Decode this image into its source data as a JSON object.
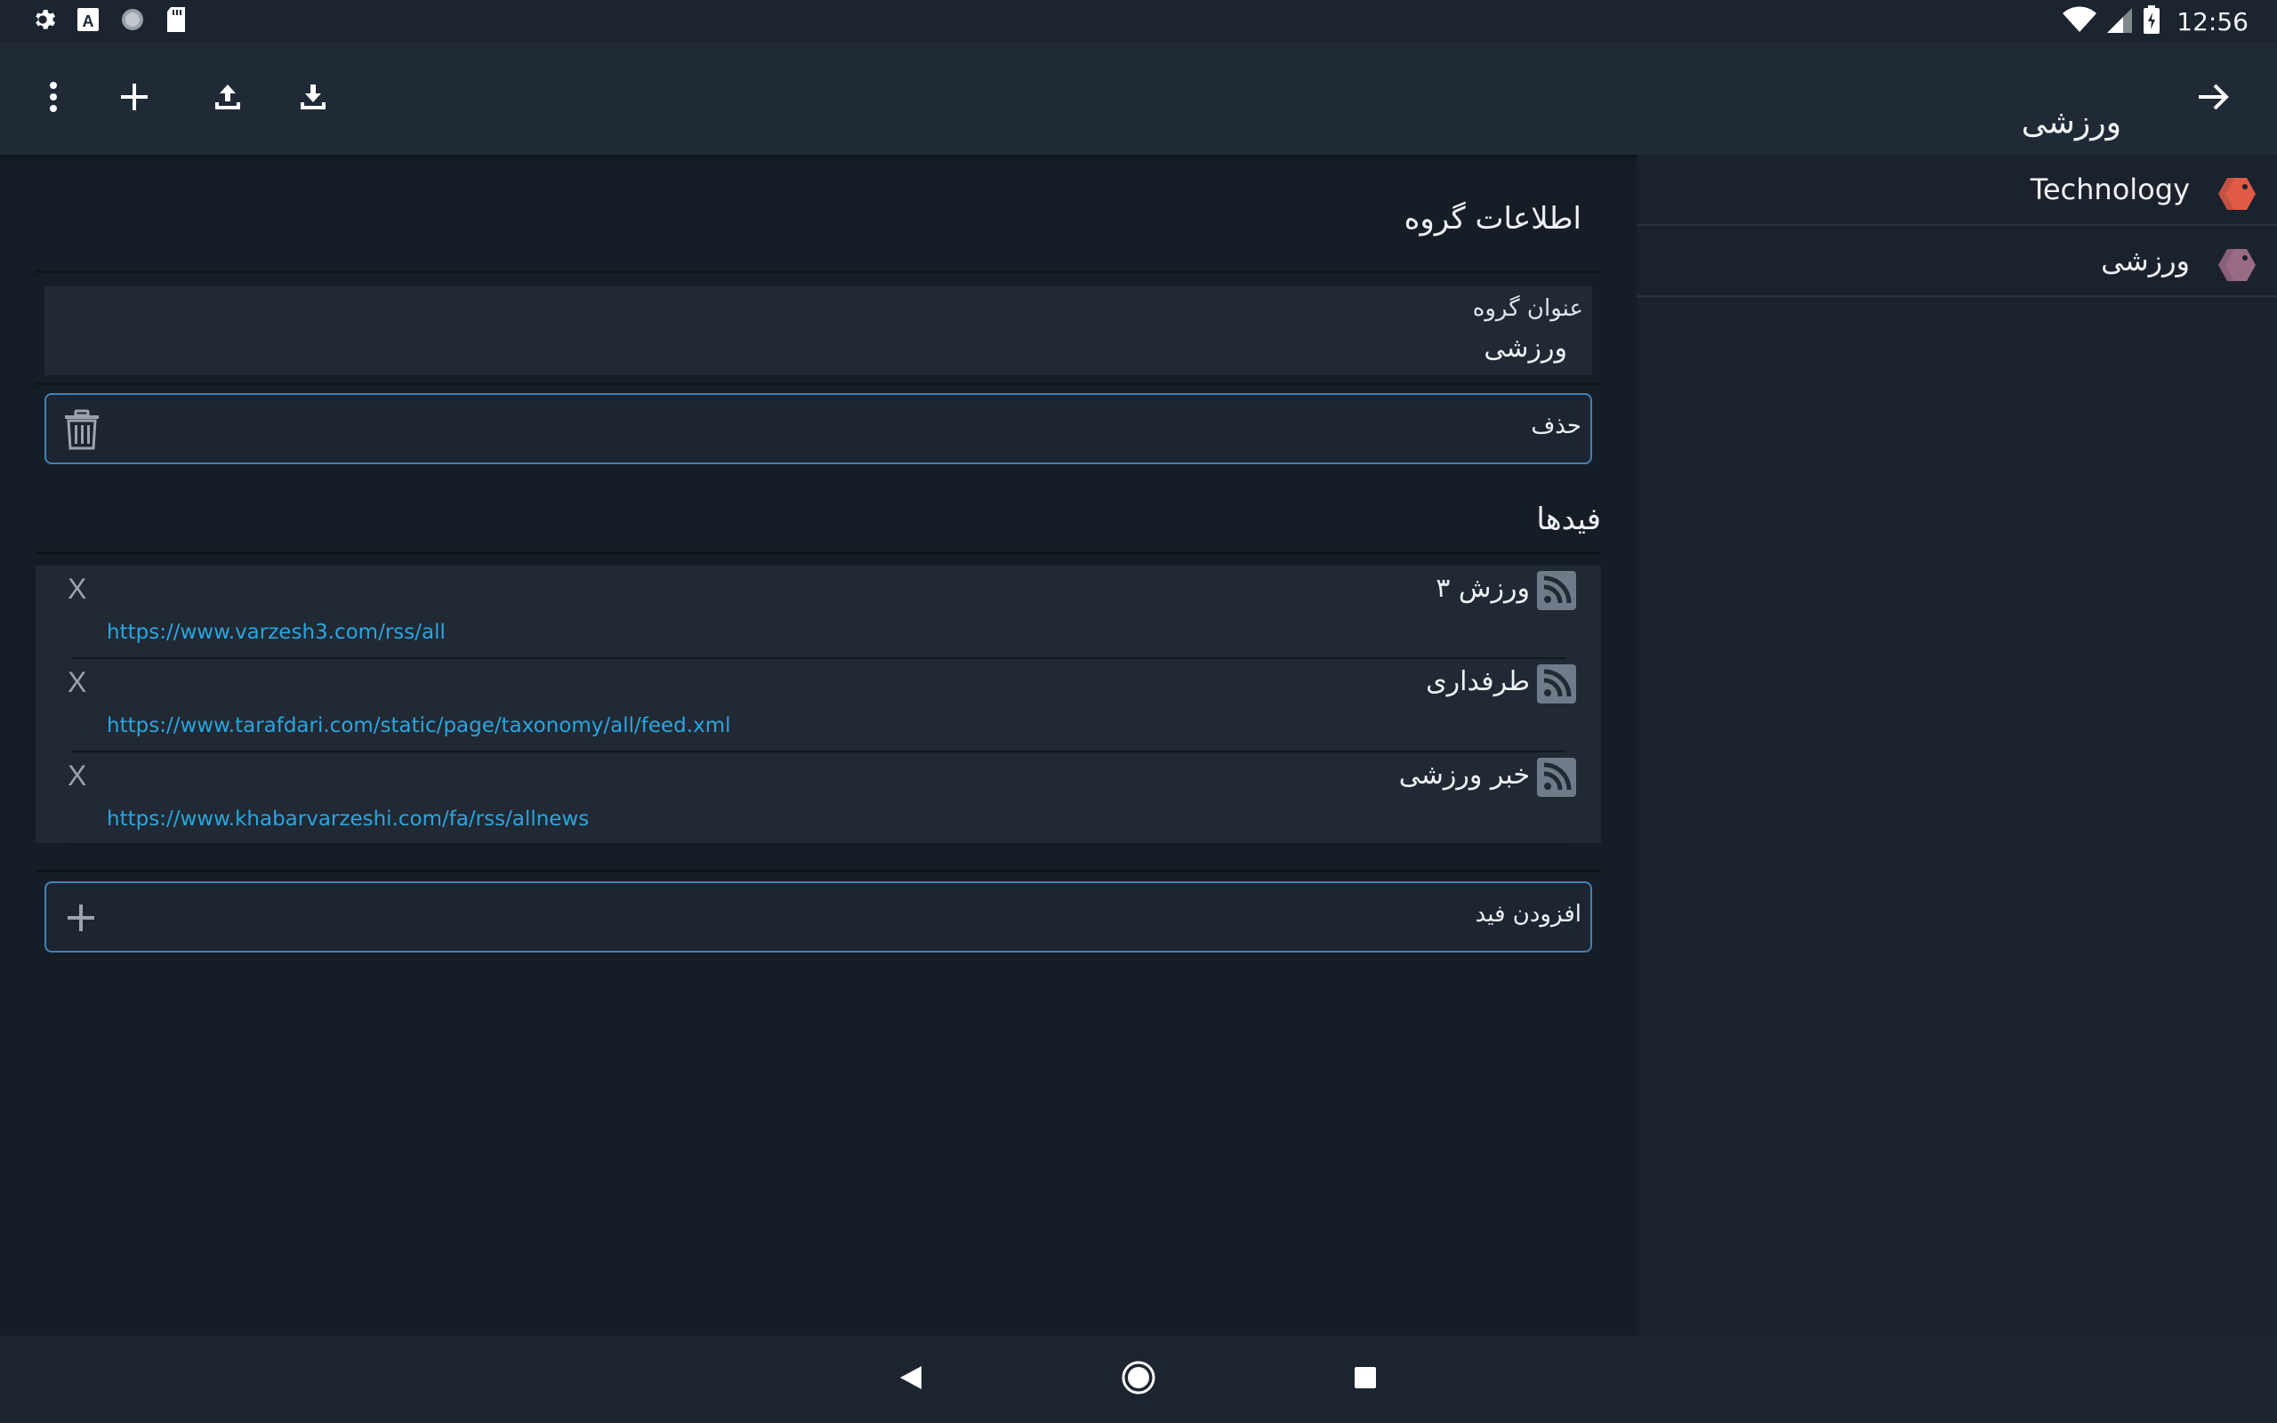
{
  "status_bar": {
    "time": "12:56",
    "icons": [
      "gear-icon",
      "text-a-icon",
      "circle-icon",
      "sd-card-icon",
      "wifi-icon",
      "signal-icon",
      "battery-icon"
    ]
  },
  "toolbar": {
    "title": "ورزشی",
    "actions": [
      "more-vert-icon",
      "add-icon",
      "upload-icon",
      "download-icon"
    ],
    "back_icon": "arrow-right-icon"
  },
  "sidebar": {
    "items": [
      {
        "label": "Technology",
        "icon": "tag-icon",
        "color": "#e05a46"
      },
      {
        "label": "ورزشی",
        "icon": "tag-icon",
        "color": "#9b6b86"
      }
    ]
  },
  "group_info": {
    "section_title": "اطلاعات گروه",
    "field_label": "عنوان گروه",
    "field_value": "ورزشی",
    "delete_label": "حذف"
  },
  "feeds": {
    "section_title": "فیدها",
    "items": [
      {
        "name": "ورزش ۳",
        "url": "https://www.varzesh3.com/rss/all",
        "remove": "X"
      },
      {
        "name": "طرفداری",
        "url": "https://www.tarafdari.com/static/page/taxonomy/all/feed.xml",
        "remove": "X"
      },
      {
        "name": "خبر ورزشی",
        "url": "https://www.khabarvarzeshi.com/fa/rss/allnews",
        "remove": "X"
      }
    ],
    "add_label": "افزودن فید"
  },
  "colors": {
    "background": "#171d26",
    "toolbar": "#202a36",
    "accent_border": "#3f82b8",
    "link": "#2aa6e0"
  }
}
